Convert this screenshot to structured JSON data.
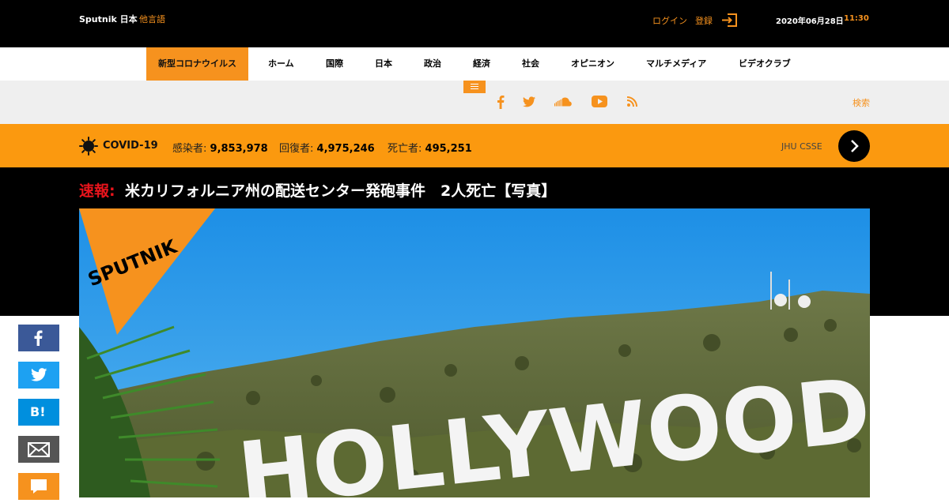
{
  "header": {
    "brand": "Sputnik 日本",
    "other_languages": "他言語",
    "login": "ログイン",
    "register": "登録",
    "date": "2020年06月28日",
    "time": "11:30"
  },
  "nav": {
    "items": [
      {
        "label": "新型コロナウイルス",
        "active": true
      },
      {
        "label": "ホーム"
      },
      {
        "label": "国際"
      },
      {
        "label": "日本"
      },
      {
        "label": "政治"
      },
      {
        "label": "経済"
      },
      {
        "label": "社会"
      },
      {
        "label": "オピニオン"
      },
      {
        "label": "マルチメディア"
      },
      {
        "label": "ビデオクラブ"
      }
    ]
  },
  "subbar": {
    "social_icons": [
      "facebook-icon",
      "twitter-icon",
      "soundcloud-icon",
      "youtube-icon",
      "rss-icon"
    ],
    "search": "検索"
  },
  "covid": {
    "label": "COVID-19",
    "infected_label": "感染者:",
    "infected": "9,853,978",
    "recovered_label": "回復者:",
    "recovered": "4,975,246",
    "deaths_label": "死亡者:",
    "deaths": "495,251",
    "source": "JHU CSSE"
  },
  "article": {
    "breaking_label": "速報:",
    "headline": "米カリフォルニア州の配送センター発砲事件　2人死亡【写真】",
    "photo_logo": "SPUTNIK",
    "photo_sign": "HOLLYWOOD"
  },
  "share": {
    "buttons": [
      "facebook-share",
      "twitter-share",
      "hatena-bookmark",
      "email-share",
      "comment"
    ],
    "hatena_label": "B!"
  },
  "colors": {
    "accent": "#f6921e",
    "covid_bar": "#fb990f",
    "breaking": "#e8141c",
    "facebook": "#3b5998",
    "twitter": "#1da1f2",
    "hatena": "#008fde",
    "email": "#555555"
  }
}
